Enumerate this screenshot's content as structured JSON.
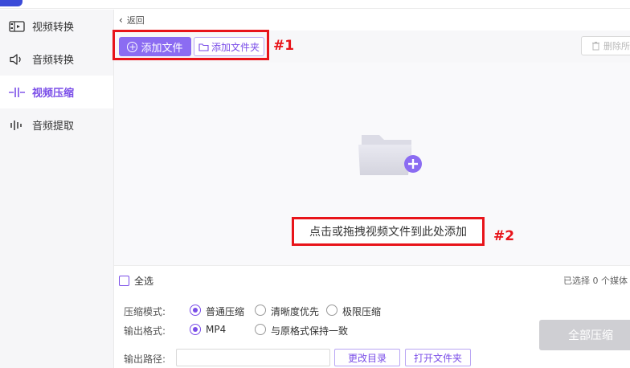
{
  "sidebar": {
    "items": [
      {
        "label": "视频转换",
        "icon": "video-convert-icon",
        "active": false
      },
      {
        "label": "音频转换",
        "icon": "speaker-icon",
        "active": false
      },
      {
        "label": "视频压缩",
        "icon": "compress-icon",
        "active": true
      },
      {
        "label": "音频提取",
        "icon": "audio-wave-icon",
        "active": false
      }
    ]
  },
  "header": {
    "back_label": "返回"
  },
  "toolbar": {
    "add_file_label": "添加文件",
    "add_folder_label": "添加文件夹",
    "delete_label": "删除所",
    "annotation_1": "#1"
  },
  "dropzone": {
    "hint": "点击或拖拽视频文件到此处添加",
    "annotation_2": "#2"
  },
  "selection": {
    "select_all_label": "全选",
    "selected_count_text": "已选择 0 个媒体"
  },
  "options": {
    "mode_label": "压缩模式:",
    "modes": [
      {
        "label": "普通压缩",
        "selected": true
      },
      {
        "label": "清晰度优先",
        "selected": false
      },
      {
        "label": "极限压缩",
        "selected": false
      }
    ],
    "format_label": "输出格式:",
    "formats": [
      {
        "label": "MP4",
        "selected": true
      },
      {
        "label": "与原格式保持一致",
        "selected": false
      }
    ],
    "path_label": "输出路径:",
    "path_value": "",
    "change_dir_label": "更改目录",
    "open_folder_label": "打开文件夹",
    "compress_all_label": "全部压缩"
  },
  "colors": {
    "accent": "#7a4de8",
    "accent_button": "#8b6cf2",
    "highlight_red": "#e8141a",
    "disabled_button": "#cfcfd3"
  }
}
